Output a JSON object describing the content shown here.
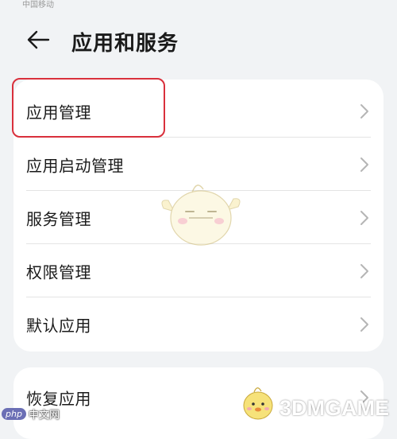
{
  "status_bar": {
    "carrier": "中国移动"
  },
  "header": {
    "title": "应用和服务",
    "back_icon": "arrow-left-icon"
  },
  "section1": {
    "items": [
      {
        "label": "应用管理"
      },
      {
        "label": "应用启动管理"
      },
      {
        "label": "服务管理"
      },
      {
        "label": "权限管理"
      },
      {
        "label": "默认应用"
      }
    ]
  },
  "section2": {
    "items": [
      {
        "label": "恢复应用"
      }
    ]
  },
  "highlight_color": "#d9303c",
  "watermarks": {
    "left_badge": "php",
    "left_text": "中文网",
    "right_text": "3DMGAME"
  }
}
